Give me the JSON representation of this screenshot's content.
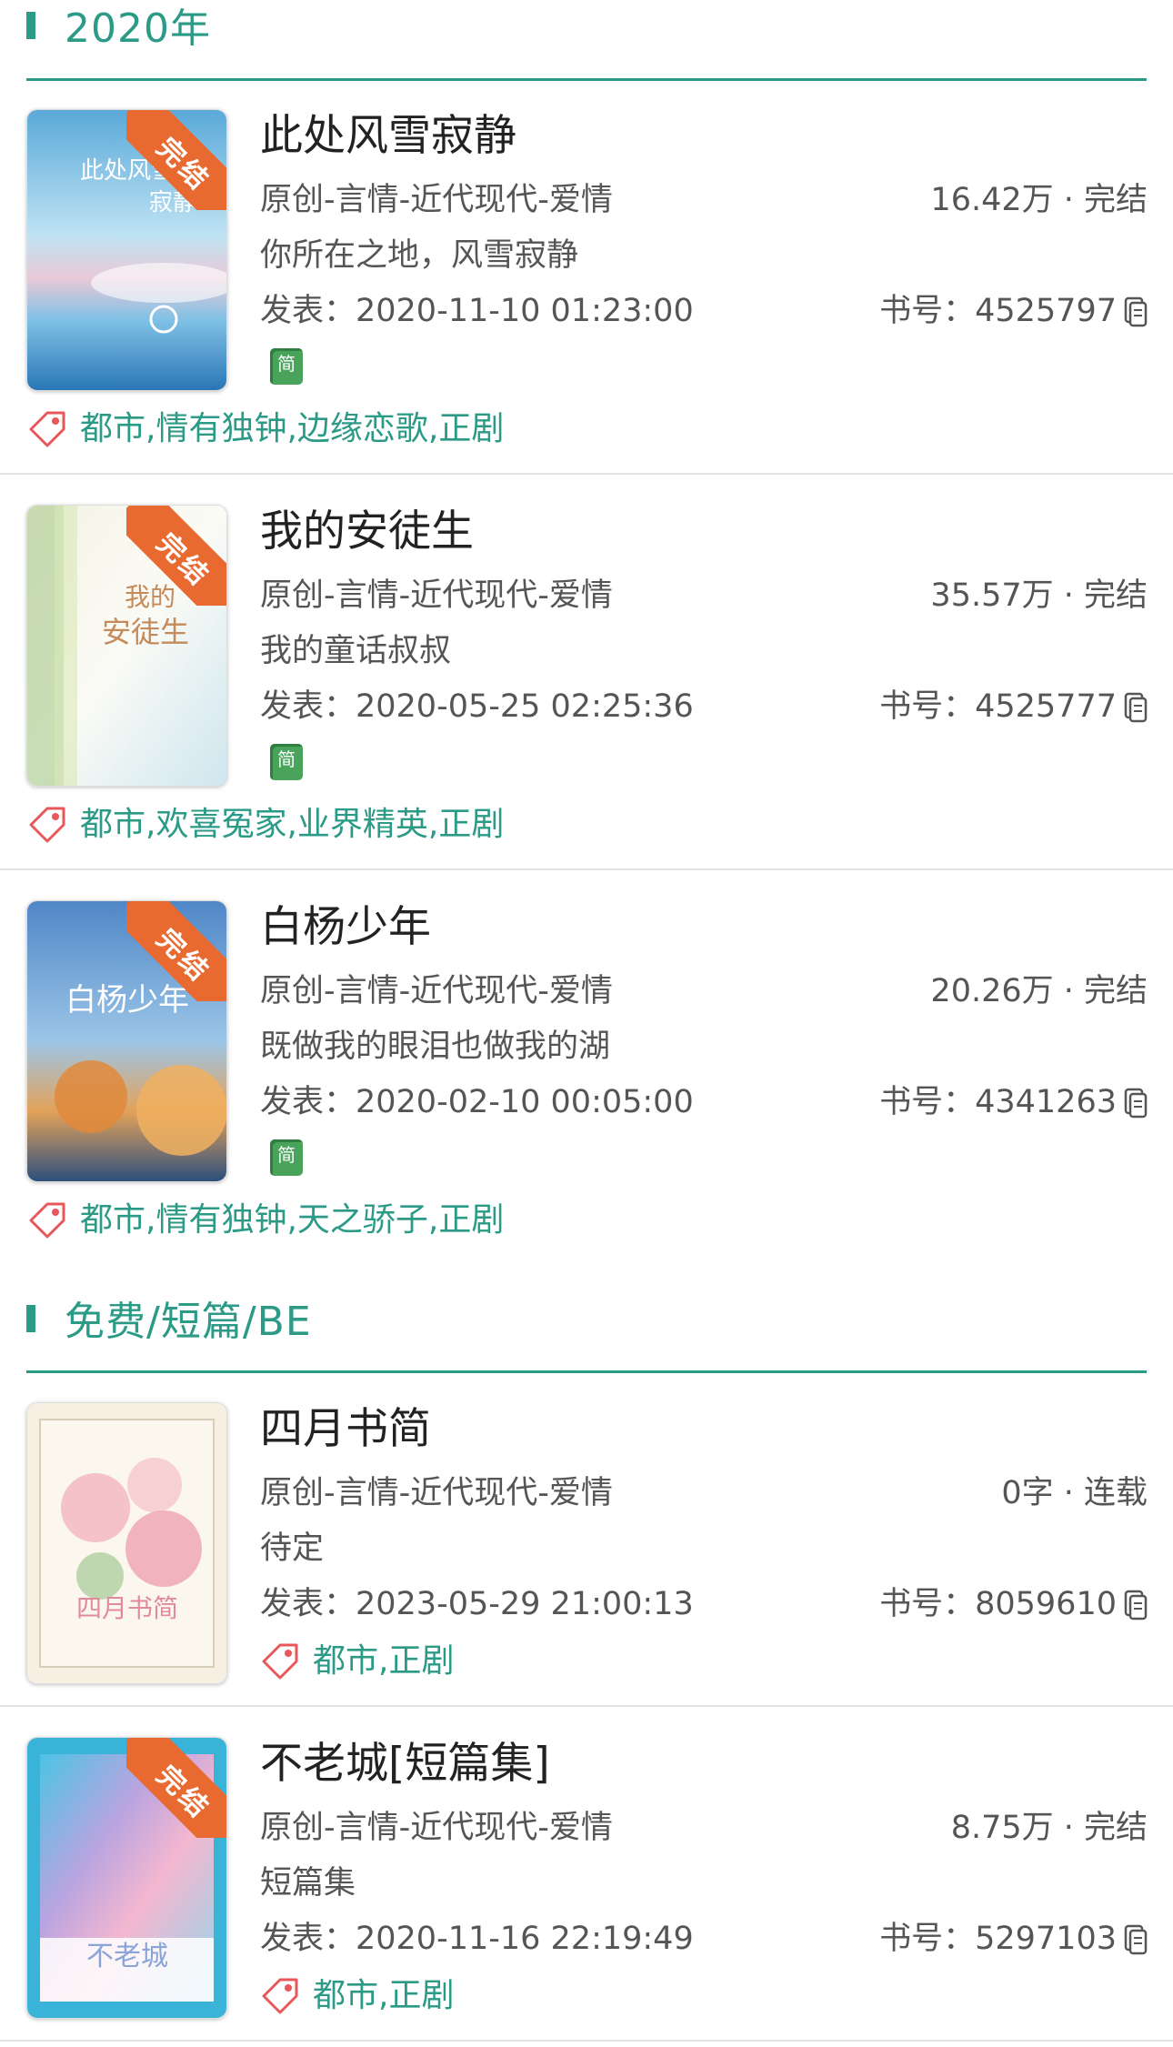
{
  "sections": [
    {
      "title": "2020年"
    },
    {
      "title": "免费/短篇/BE"
    }
  ],
  "books": [
    {
      "title": "此处风雪寂静",
      "category": "原创-言情-近代现代-爱情",
      "stats": "16.42万 · 完结",
      "intro": "你所在之地，风雪寂静",
      "date": "发表：2020-11-10 01:23:00",
      "book_id": "书号：4525797",
      "ribbon": "完结",
      "jian": "简",
      "tags": "都市,情有独钟,边缘恋歌,正剧"
    },
    {
      "title": "我的安徒生",
      "category": "原创-言情-近代现代-爱情",
      "stats": "35.57万 · 完结",
      "intro": "我的童话叔叔",
      "date": "发表：2020-05-25 02:25:36",
      "book_id": "书号：4525777",
      "ribbon": "完结",
      "jian": "简",
      "tags": "都市,欢喜冤家,业界精英,正剧"
    },
    {
      "title": "白杨少年",
      "category": "原创-言情-近代现代-爱情",
      "stats": "20.26万 · 完结",
      "intro": "既做我的眼泪也做我的湖",
      "date": "发表：2020-02-10 00:05:00",
      "book_id": "书号：4341263",
      "ribbon": "完结",
      "jian": "简",
      "tags": "都市,情有独钟,天之骄子,正剧"
    },
    {
      "title": "四月书简",
      "category": "原创-言情-近代现代-爱情",
      "stats": "0字 · 连载",
      "intro": "待定",
      "date": "发表：2023-05-29 21:00:13",
      "book_id": "书号：8059610",
      "tags": "都市,正剧"
    },
    {
      "title": "不老城[短篇集]",
      "category": "原创-言情-近代现代-爱情",
      "stats": "8.75万 · 完结",
      "intro": "短篇集",
      "date": "发表：2020-11-16 22:19:49",
      "book_id": "书号：5297103",
      "ribbon": "完结",
      "tags": "都市,正剧"
    }
  ],
  "colors": {
    "accent": "#2b9a86",
    "ribbon": "#e86a30",
    "tag_icon": "#e8575a",
    "jian_badge": "#4aa35b"
  },
  "icons": {
    "tag": "tag-icon",
    "copy": "copy-icon",
    "jian_badge": "book-icon"
  }
}
